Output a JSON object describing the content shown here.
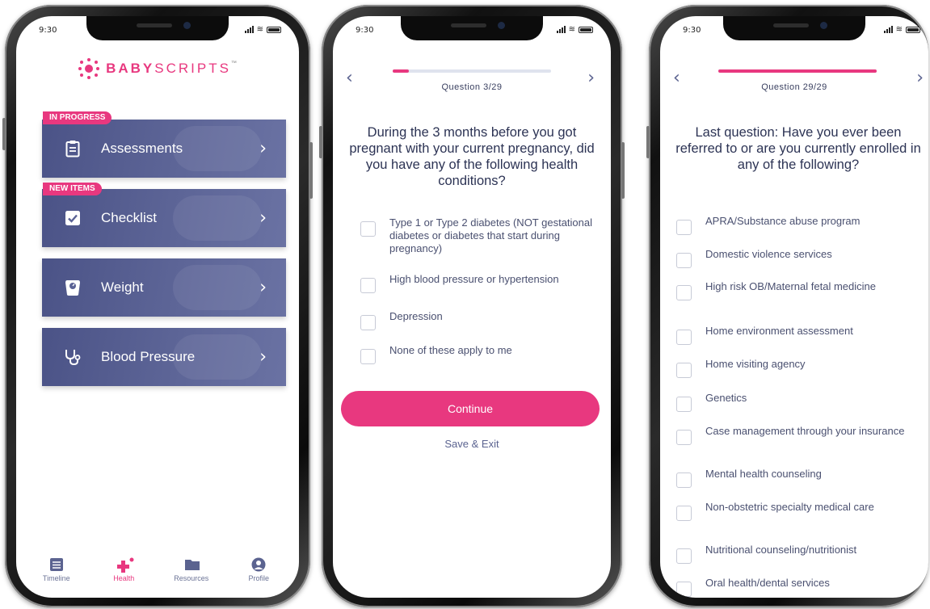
{
  "status_bar": {
    "time": "9:30"
  },
  "phone1": {
    "logo": {
      "brand_bold": "BABY",
      "brand_rest": "SCRIPTS",
      "tm": "™"
    },
    "cards": [
      {
        "label": "Assessments",
        "tag": "IN PROGRESS",
        "icon": "clipboard-icon"
      },
      {
        "label": "Checklist",
        "tag": "NEW ITEMS",
        "icon": "checkbox-icon"
      },
      {
        "label": "Weight",
        "tag": "",
        "icon": "scale-icon"
      },
      {
        "label": "Blood Pressure",
        "tag": "",
        "icon": "stethoscope-icon"
      }
    ],
    "tabs": [
      {
        "label": "Timeline",
        "icon": "timeline-icon",
        "active": false
      },
      {
        "label": "Health",
        "icon": "health-plus-icon",
        "active": true
      },
      {
        "label": "Resources",
        "icon": "folder-icon",
        "active": false
      },
      {
        "label": "Profile",
        "icon": "profile-icon",
        "active": false
      }
    ]
  },
  "phone2": {
    "question_counter": "Question 3/29",
    "progress": 0.103,
    "question": "During the 3 months before you got pregnant with your current pregnancy, did you have any of the following health conditions?",
    "options": [
      "Type 1 or Type 2 diabetes (NOT gestational diabetes or diabetes that start during pregnancy)",
      "High blood pressure or hypertension",
      "Depression",
      "None of these apply to me"
    ],
    "continue_label": "Continue",
    "save_exit_label": "Save & Exit"
  },
  "phone3": {
    "question_counter": "Question 29/29",
    "progress": 1.0,
    "question": "Last question: Have you ever been referred to or are you currently enrolled in any of the following?",
    "options": [
      "APRA/Substance abuse program",
      "Domestic violence services",
      "High risk OB/Maternal fetal medicine",
      "Home environment assessment",
      "Home visiting agency",
      "Genetics",
      "Case management through your insurance",
      "Mental health counseling",
      "Non-obstetric specialty medical care",
      "Nutritional counseling/nutritionist",
      "Oral health/dental services"
    ]
  },
  "colors": {
    "accent": "#e8387f",
    "card": "#5a6295",
    "text": "#2c3354"
  }
}
